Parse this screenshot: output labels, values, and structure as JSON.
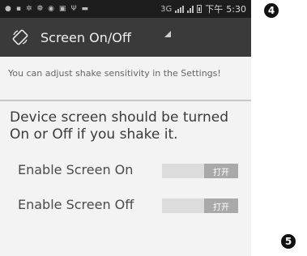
{
  "status_bar": {
    "network": "3G",
    "time_label": "下午",
    "time": "5:30"
  },
  "app_bar": {
    "title": "Screen On/Off",
    "icon": "screen-rotate-icon"
  },
  "hint_text": "You can adjust shake sensitivity in the Settings!",
  "description": "Device screen should be turned On or Off if you shake it.",
  "settings": [
    {
      "label": "Enable Screen On",
      "toggle_text": "打开"
    },
    {
      "label": "Enable Screen Off",
      "toggle_text": "打开"
    }
  ],
  "callouts": [
    "4",
    "5"
  ],
  "colors": {
    "status_bar": "#1d1d1d",
    "action_bar": "#3a3a3a",
    "background": "#f3f3f3",
    "toggle_track": "#dcdcdc",
    "toggle_knob": "#a9a9a9"
  }
}
